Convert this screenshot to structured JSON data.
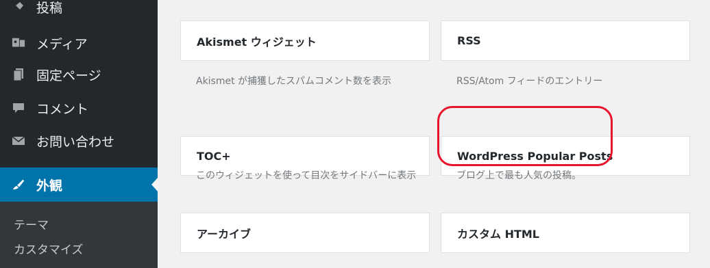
{
  "sidebar": {
    "items": [
      {
        "id": "posts",
        "label": "投稿",
        "icon": "pin-icon"
      },
      {
        "id": "media",
        "label": "メディア",
        "icon": "media-icon"
      },
      {
        "id": "pages",
        "label": "固定ページ",
        "icon": "page-icon"
      },
      {
        "id": "comments",
        "label": "コメント",
        "icon": "comment-icon"
      },
      {
        "id": "contact",
        "label": "お問い合わせ",
        "icon": "mail-icon"
      },
      {
        "id": "appearance",
        "label": "外観",
        "icon": "brush-icon",
        "active": true
      }
    ],
    "submenu": [
      {
        "label": "テーマ"
      },
      {
        "label": "カスタマイズ"
      }
    ],
    "colors": {
      "background": "#23282d",
      "active": "#0073aa",
      "submenu_bg": "#32373c"
    }
  },
  "widgets": [
    {
      "title": "Akismet ウィジェット",
      "description": "Akismet が捕獲したスパムコメント数を表示"
    },
    {
      "title": "RSS",
      "description": "RSS/Atom フィードのエントリー"
    },
    {
      "title": "TOC+",
      "description": "このウィジェットを使って目次をサイドバーに表示"
    },
    {
      "title": "WordPress Popular Posts",
      "description": "ブログ上で最も人気の投稿。",
      "highlighted": true
    },
    {
      "title": "アーカイブ",
      "description": ""
    },
    {
      "title": "カスタム HTML",
      "description": ""
    }
  ],
  "highlight_color": "#e8132c"
}
